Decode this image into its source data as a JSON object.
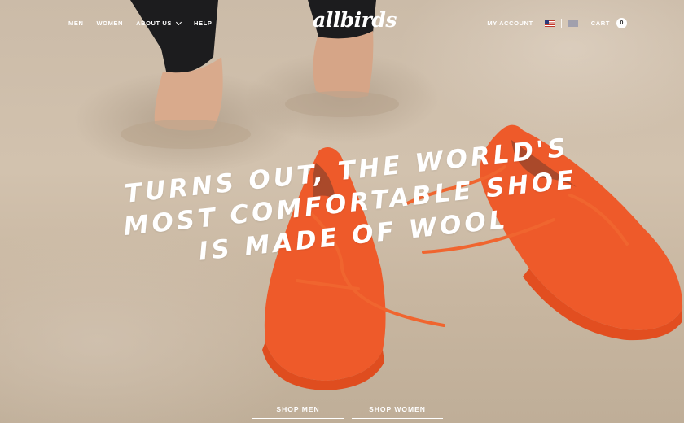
{
  "header": {
    "nav_left": [
      {
        "label": "MEN"
      },
      {
        "label": "WOMEN"
      },
      {
        "label": "ABOUT US",
        "dropdown": true
      },
      {
        "label": "HELP"
      }
    ],
    "logo": "allbirds",
    "account_label": "MY ACCOUNT",
    "cart_label": "CART",
    "cart_count": "0",
    "flags": [
      "us-flag-icon",
      "uk-flag-icon"
    ]
  },
  "hero": {
    "headline_lines": [
      "TURNS OUT, THE WORLD'S",
      "MOST COMFORTABLE SHOE",
      "IS MADE OF WOOL"
    ],
    "cta_men": "SHOP MEN",
    "cta_women": "SHOP WOMEN"
  },
  "colors": {
    "shoe_orange": "#ee5a2a",
    "sand": "#cbbba8",
    "text": "#ffffff"
  }
}
